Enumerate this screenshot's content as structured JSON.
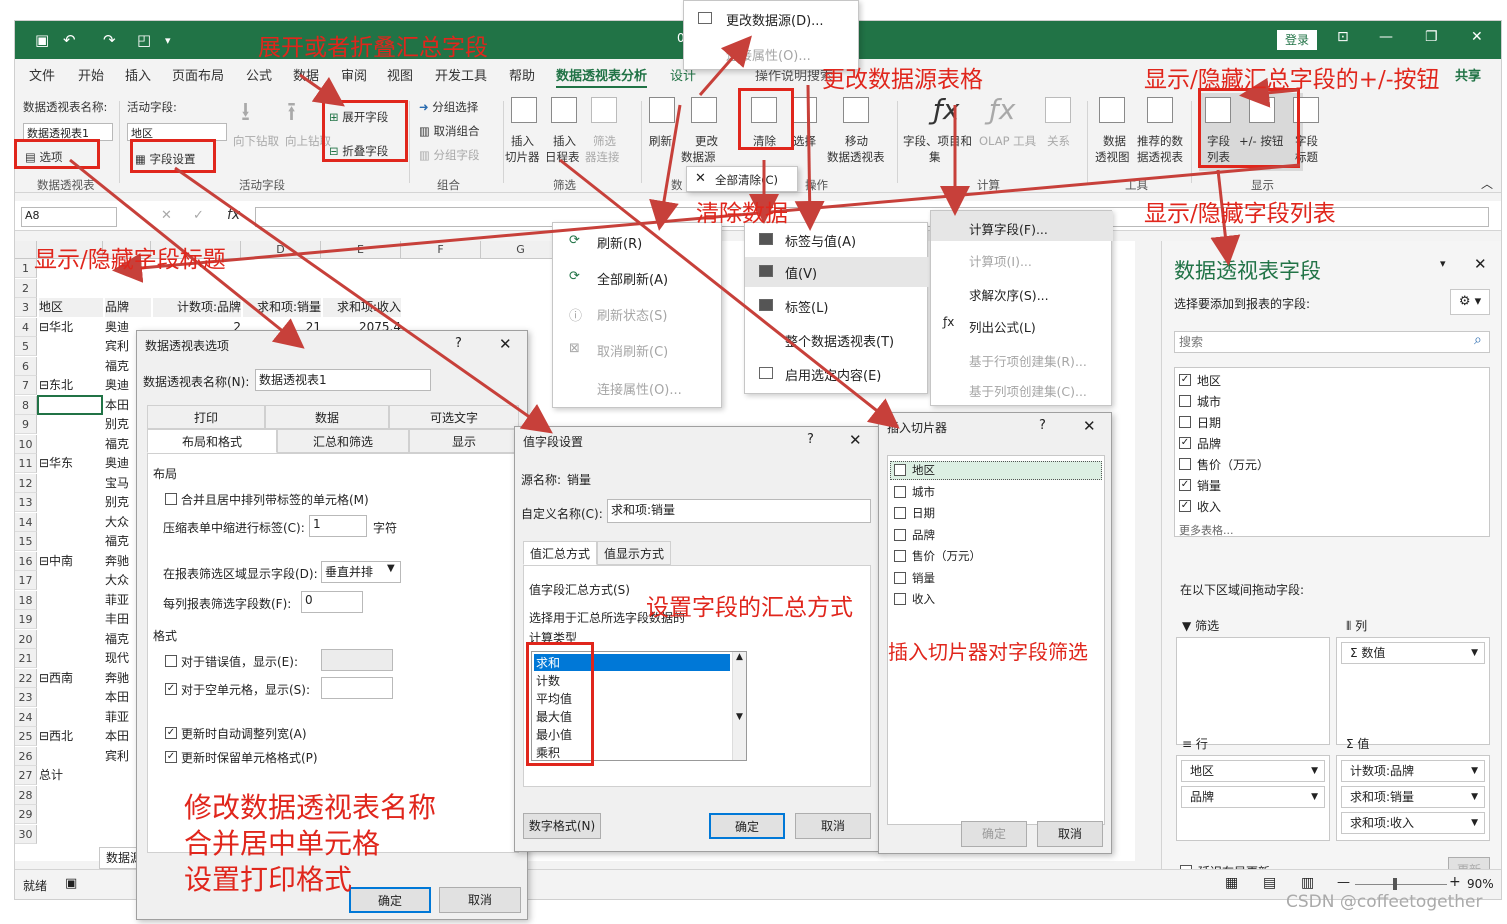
{
  "titlebar": {
    "doc_char": "0",
    "login": "登录"
  },
  "menus": [
    "文件",
    "开始",
    "插入",
    "页面布局",
    "公式",
    "数据",
    "审阅",
    "视图",
    "开发工具",
    "帮助",
    "数据透视表分析",
    "设计",
    "操作说明搜索",
    "共享"
  ],
  "ribbon": {
    "pt_name_label": "数据透视表名称:",
    "pt_name_value": "数据透视表1",
    "options": "选项",
    "group_pt": "数据透视表",
    "active_field_label": "活动字段:",
    "active_field_value": "地区",
    "field_settings": "字段设置",
    "drill_down": "向下钻取",
    "drill_up": "向上钻取",
    "expand": "展开字段",
    "collapse": "折叠字段",
    "group_active": "活动字段",
    "group_sel": "分组选择",
    "ungroup": "取消组合",
    "group_field": "分组字段",
    "group_group": "组合",
    "slicer_a": "插入",
    "slicer_b": "切片器",
    "timeline_a": "插入",
    "timeline_b": "日程表",
    "filter_conn_a": "筛选",
    "filter_conn_b": "器连接",
    "group_filter": "筛选",
    "refresh": "刷新",
    "change_src_a": "更改",
    "change_src_b": "数据源",
    "group_data": "数",
    "clear": "清除",
    "select": "选择",
    "move_a": "移动",
    "move_b": "数据透视表",
    "group_actions": "操作",
    "fields_items": "字段、项目和",
    "sets": "集",
    "olap": "OLAP 工具",
    "relations": "关系",
    "group_calc": "计算",
    "pivotchart_a": "数据",
    "pivotchart_b": "透视图",
    "recommended_a": "推荐的数",
    "recommended_b": "据透视表",
    "group_tools": "工具",
    "field_list_a": "字段",
    "field_list_b": "列表",
    "plusminus": "+/- 按钮",
    "field_headers_a": "字段",
    "field_headers_b": "标题",
    "group_show": "显示"
  },
  "formula": {
    "namebox": "A8",
    "fx": "fx"
  },
  "sheet": {
    "col_headers": [
      "D",
      "E",
      "F",
      "G"
    ],
    "rows": [
      {
        "n": "1",
        "a": "",
        "b": "",
        "c": "",
        "d": "",
        "e": ""
      },
      {
        "n": "2",
        "a": "",
        "b": "",
        "c": "",
        "d": "",
        "e": ""
      },
      {
        "n": "3",
        "a": "地区",
        "b": "品牌",
        "c": "计数项:品牌",
        "d": "求和项:销量",
        "e": "求和项:收入"
      },
      {
        "n": "4",
        "a": "⊟华北",
        "b": "奥迪",
        "c": "2",
        "d": "21",
        "e": "2075.4"
      },
      {
        "n": "5",
        "a": "",
        "b": "宾利",
        "c": "",
        "d": "",
        "e": ""
      },
      {
        "n": "6",
        "a": "",
        "b": "福克",
        "c": "",
        "d": "",
        "e": ""
      },
      {
        "n": "7",
        "a": "⊟东北",
        "b": "奥迪",
        "c": "",
        "d": "",
        "e": ""
      },
      {
        "n": "8",
        "a": "",
        "b": "本田",
        "c": "",
        "d": "",
        "e": ""
      },
      {
        "n": "9",
        "a": "",
        "b": "别克",
        "c": "",
        "d": "",
        "e": ""
      },
      {
        "n": "10",
        "a": "",
        "b": "福克",
        "c": "",
        "d": "",
        "e": ""
      },
      {
        "n": "11",
        "a": "⊟华东",
        "b": "奥迪",
        "c": "",
        "d": "",
        "e": ""
      },
      {
        "n": "12",
        "a": "",
        "b": "宝马",
        "c": "",
        "d": "",
        "e": ""
      },
      {
        "n": "13",
        "a": "",
        "b": "别克",
        "c": "",
        "d": "",
        "e": ""
      },
      {
        "n": "14",
        "a": "",
        "b": "大众",
        "c": "",
        "d": "",
        "e": ""
      },
      {
        "n": "15",
        "a": "",
        "b": "福克",
        "c": "",
        "d": "",
        "e": ""
      },
      {
        "n": "16",
        "a": "⊟中南",
        "b": "奔驰",
        "c": "",
        "d": "",
        "e": ""
      },
      {
        "n": "17",
        "a": "",
        "b": "大众",
        "c": "",
        "d": "",
        "e": ""
      },
      {
        "n": "18",
        "a": "",
        "b": "菲亚",
        "c": "",
        "d": "",
        "e": ""
      },
      {
        "n": "19",
        "a": "",
        "b": "丰田",
        "c": "",
        "d": "",
        "e": ""
      },
      {
        "n": "20",
        "a": "",
        "b": "福克",
        "c": "",
        "d": "",
        "e": ""
      },
      {
        "n": "21",
        "a": "",
        "b": "现代",
        "c": "",
        "d": "",
        "e": ""
      },
      {
        "n": "22",
        "a": "⊟西南",
        "b": "奔驰",
        "c": "",
        "d": "",
        "e": ""
      },
      {
        "n": "23",
        "a": "",
        "b": "本田",
        "c": "",
        "d": "",
        "e": ""
      },
      {
        "n": "24",
        "a": "",
        "b": "菲亚",
        "c": "",
        "d": "",
        "e": ""
      },
      {
        "n": "25",
        "a": "⊟西北",
        "b": "本田",
        "c": "",
        "d": "",
        "e": ""
      },
      {
        "n": "26",
        "a": "",
        "b": "宾利",
        "c": "",
        "d": "",
        "e": ""
      },
      {
        "n": "27",
        "a": "总计",
        "b": "",
        "c": "",
        "d": "",
        "e": ""
      },
      {
        "n": "28",
        "a": "",
        "b": "",
        "c": "",
        "d": "",
        "e": ""
      },
      {
        "n": "29",
        "a": "",
        "b": "",
        "c": "",
        "d": "",
        "e": ""
      },
      {
        "n": "30",
        "a": "",
        "b": "",
        "c": "",
        "d": "",
        "e": ""
      }
    ],
    "sheet_tab": "数据源"
  },
  "pt_options": {
    "title": "数据透视表选项",
    "q": "?",
    "name_label": "数据透视表名称(N):",
    "name_value": "数据透视表1",
    "tabs_top": [
      "打印",
      "数据",
      "可选文字"
    ],
    "tabs_bottom": [
      "布局和格式",
      "汇总和筛选",
      "显示"
    ],
    "sec_layout": "布局",
    "merge": "合并且居中排列带标签的单元格(M)",
    "indent_label": "压缩表单中缩进行标签(C):",
    "indent_value": "1",
    "indent_unit": "字符",
    "filter_area_label": "在报表筛选区域显示字段(D):",
    "filter_area_value": "垂直并排",
    "per_col_label": "每列报表筛选字段数(F):",
    "per_col_value": "0",
    "sec_format": "格式",
    "err_label": "对于错误值，显示(E):",
    "empty_label": "对于空单元格，显示(S):",
    "autofit": "更新时自动调整列宽(A)",
    "keepfmt": "更新时保留单元格格式(P)",
    "ok": "确定",
    "cancel": "取消"
  },
  "vf_settings": {
    "title": "值字段设置",
    "q": "?",
    "src_label": "源名称:",
    "src_value": "销量",
    "custom_label": "自定义名称(C):",
    "custom_value": "求和项:销量",
    "tab1": "值汇总方式",
    "tab2": "值显示方式",
    "sum_label": "值字段汇总方式(S)",
    "desc1": "选择用于汇总所选字段数据的",
    "desc2": "计算类型",
    "list": [
      "求和",
      "计数",
      "平均值",
      "最大值",
      "最小值",
      "乘积"
    ],
    "numfmt": "数字格式(N)",
    "ok": "确定",
    "cancel": "取消"
  },
  "slicer": {
    "title": "插入切片器",
    "q": "?",
    "items": [
      "地区",
      "城市",
      "日期",
      "品牌",
      "售价（万元）",
      "销量",
      "收入"
    ],
    "ok": "确定",
    "cancel": "取消"
  },
  "change_src_menu": {
    "item1": "更改数据源(D)...",
    "item2": "连接属性(O)..."
  },
  "refresh_menu": [
    "刷新(R)",
    "全部刷新(A)",
    "刷新状态(S)",
    "取消刷新(C)",
    "连接属性(O)..."
  ],
  "clear_menu": {
    "header": "全部清除(C)",
    "items": [
      "标签与值(A)",
      "值(V)",
      "标签(L)",
      "整个数据透视表(T)",
      "启用选定内容(E)"
    ]
  },
  "calc_menu": [
    "计算字段(F)...",
    "计算项(I)...",
    "求解次序(S)...",
    "列出公式(L)",
    "基于行项创建集(R)...",
    "基于列项创建集(C)..."
  ],
  "field_pane": {
    "title": "数据透视表字段",
    "subtitle": "选择要添加到报表的字段:",
    "search": "搜索",
    "fields": [
      {
        "name": "地区",
        "checked": "✓"
      },
      {
        "name": "城市",
        "checked": ""
      },
      {
        "name": "日期",
        "checked": ""
      },
      {
        "name": "品牌",
        "checked": "✓"
      },
      {
        "name": "售价（万元）",
        "checked": ""
      },
      {
        "name": "销量",
        "checked": "✓"
      },
      {
        "name": "收入",
        "checked": "✓"
      }
    ],
    "more": "更多表格...",
    "drag_label": "在以下区域间拖动字段:",
    "filter": "筛选",
    "columns": "列",
    "rows": "行",
    "values": "值",
    "col_item": "Σ 数值",
    "row_items": [
      "地区",
      "品牌"
    ],
    "val_items": [
      "计数项:品牌",
      "求和项:销量",
      "求和项:收入"
    ],
    "defer": "延迟布局更新",
    "update": "更新"
  },
  "status": {
    "ready": "就绪",
    "zoom": "90%"
  },
  "annotations": {
    "expand": "展开或者折叠汇总字段",
    "change_src": "更改数据源表格",
    "plusminus": "显示/隐藏汇总字段的+/-按钮",
    "clear": "清除数据",
    "fieldlist": "显示/隐藏字段列表",
    "headers": "显示/隐藏字段标题",
    "summarize": "设置字段的汇总方式",
    "slicer": "插入切片器对字段筛选",
    "ptopt1": "修改数据透视表名称",
    "ptopt2": "合并居中单元格",
    "ptopt3": "设置打印格式"
  },
  "watermark": "CSDN @coffeetogether",
  "colors": {
    "excel_green": "#217346",
    "annotation_red": "#e0261c",
    "selection_blue": "#0078d7"
  }
}
